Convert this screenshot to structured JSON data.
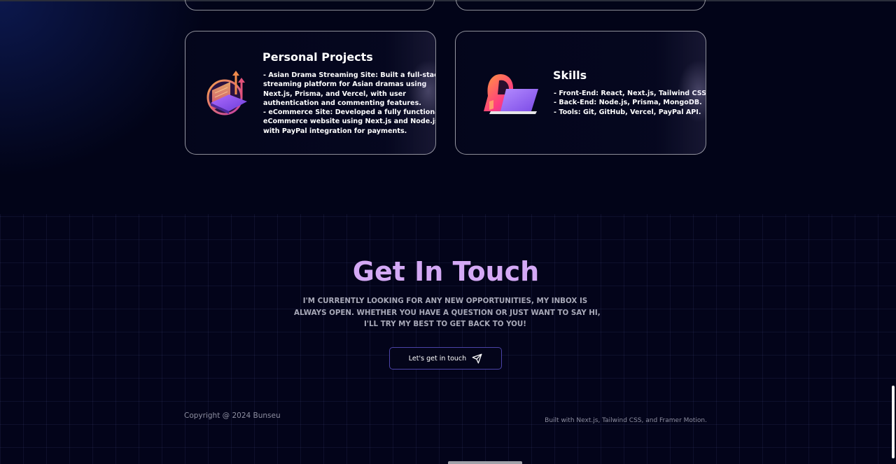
{
  "projects_section": {
    "cards": [
      {
        "title": "Personal Projects",
        "icon": "projects-chart-icon",
        "lines": [
          "- Asian Drama Streaming Site: Built a full-stack",
          "streaming platform for Asian dramas using",
          "Next.js, Prisma, and Vercel, with user",
          "authentication and commenting features.",
          "- eCommerce Site: Developed a fully functional",
          "eCommerce website using Next.js and Node.js,",
          "with PayPal integration for payments."
        ]
      },
      {
        "title": "Skills",
        "icon": "hooded-coder-icon",
        "lines": [
          "- Front-End: React, Next.js, Tailwind CSS.",
          "- Back-End: Node.js, Prisma, MongoDB.",
          "- Tools: Git, GitHub, Vercel, PayPal API."
        ]
      }
    ]
  },
  "contact": {
    "title": "Get In Touch",
    "text_lines": [
      "I'M CURRENTLY LOOKING FOR ANY NEW OPPORTUNITIES, MY INBOX IS",
      "ALWAYS OPEN. WHETHER YOU HAVE A QUESTION OR JUST WANT TO SAY HI,",
      "I'LL TRY MY BEST TO GET BACK TO YOU!"
    ],
    "button_label": "Let's get in touch",
    "button_icon": "paper-plane-icon"
  },
  "footer": {
    "copyright": "Copyright @ 2024 Bunseu",
    "built_with": "Built with Next.js, Tailwind CSS, and Framer Motion."
  },
  "colors": {
    "background": "#020418",
    "accent_title": "#d4a9f5",
    "button_border": "#4b43a8",
    "muted_text": "#a8a9b8"
  }
}
